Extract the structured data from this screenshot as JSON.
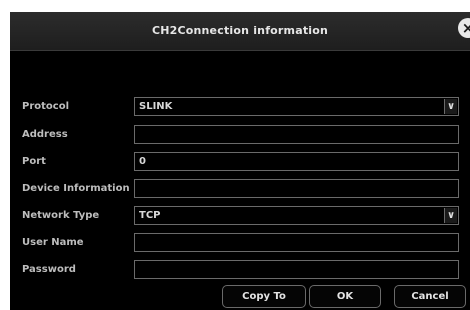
{
  "dialog": {
    "title": "CH2Connection information",
    "close_glyph": "×"
  },
  "form": {
    "protocol": {
      "label": "Protocol",
      "value": "SLINK"
    },
    "address": {
      "label": "Address",
      "value": ""
    },
    "port": {
      "label": "Port",
      "value": "0"
    },
    "device_info": {
      "label": "Device Information",
      "value": ""
    },
    "network_type": {
      "label": "Network Type",
      "value": "TCP"
    },
    "user_name": {
      "label": "User Name",
      "value": ""
    },
    "password": {
      "label": "Password",
      "value": ""
    }
  },
  "buttons": {
    "copy_to": "Copy To",
    "ok": "OK",
    "cancel": "Cancel"
  },
  "icons": {
    "dropdown": "chevron-down-icon",
    "close": "close-icon"
  }
}
